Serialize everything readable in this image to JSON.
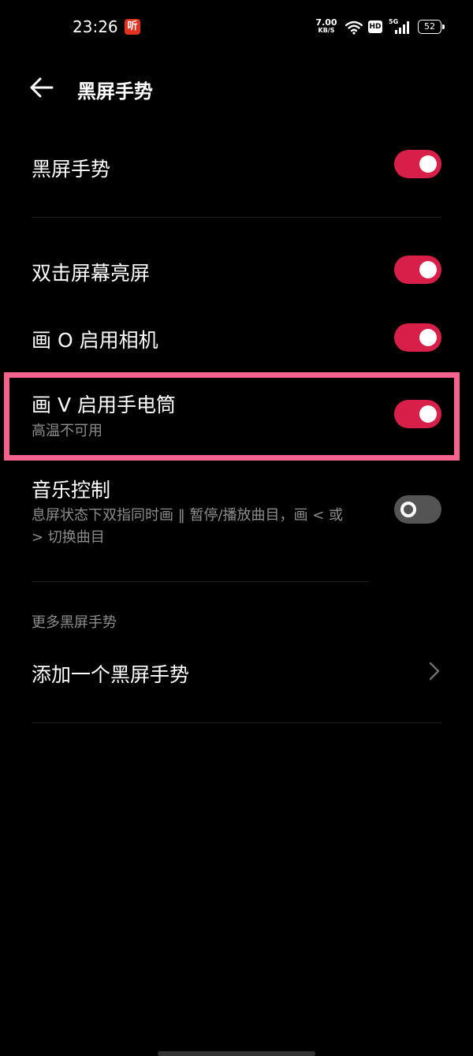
{
  "status_bar": {
    "time": "23:26",
    "app_badge": "听",
    "net_speed_value": "7.00",
    "net_speed_unit": "KB/S",
    "hd_label": "HD",
    "signal_label": "5G",
    "battery": "52"
  },
  "header": {
    "title": "黑屏手势"
  },
  "settings": [
    {
      "title": "黑屏手势",
      "enabled": true
    },
    {
      "title": "双击屏幕亮屏",
      "enabled": true
    },
    {
      "title": "画 O 启用相机",
      "enabled": true
    },
    {
      "title": "画 V 启用手电筒",
      "subtitle": "高温不可用",
      "enabled": true
    },
    {
      "title": "音乐控制",
      "subtitle_line1": "息屏状态下双指同时画 ‖ 暂停/播放曲目，画 < 或",
      "subtitle_line2": "> 切换曲目",
      "enabled": false
    }
  ],
  "more_section": {
    "header": "更多黑屏手势",
    "add_label": "添加一个黑屏手势"
  },
  "colors": {
    "accent": "#d81f49",
    "toggle_off": "#545454",
    "highlight": "#f4628d",
    "secondary_text": "#8c8c8c"
  }
}
